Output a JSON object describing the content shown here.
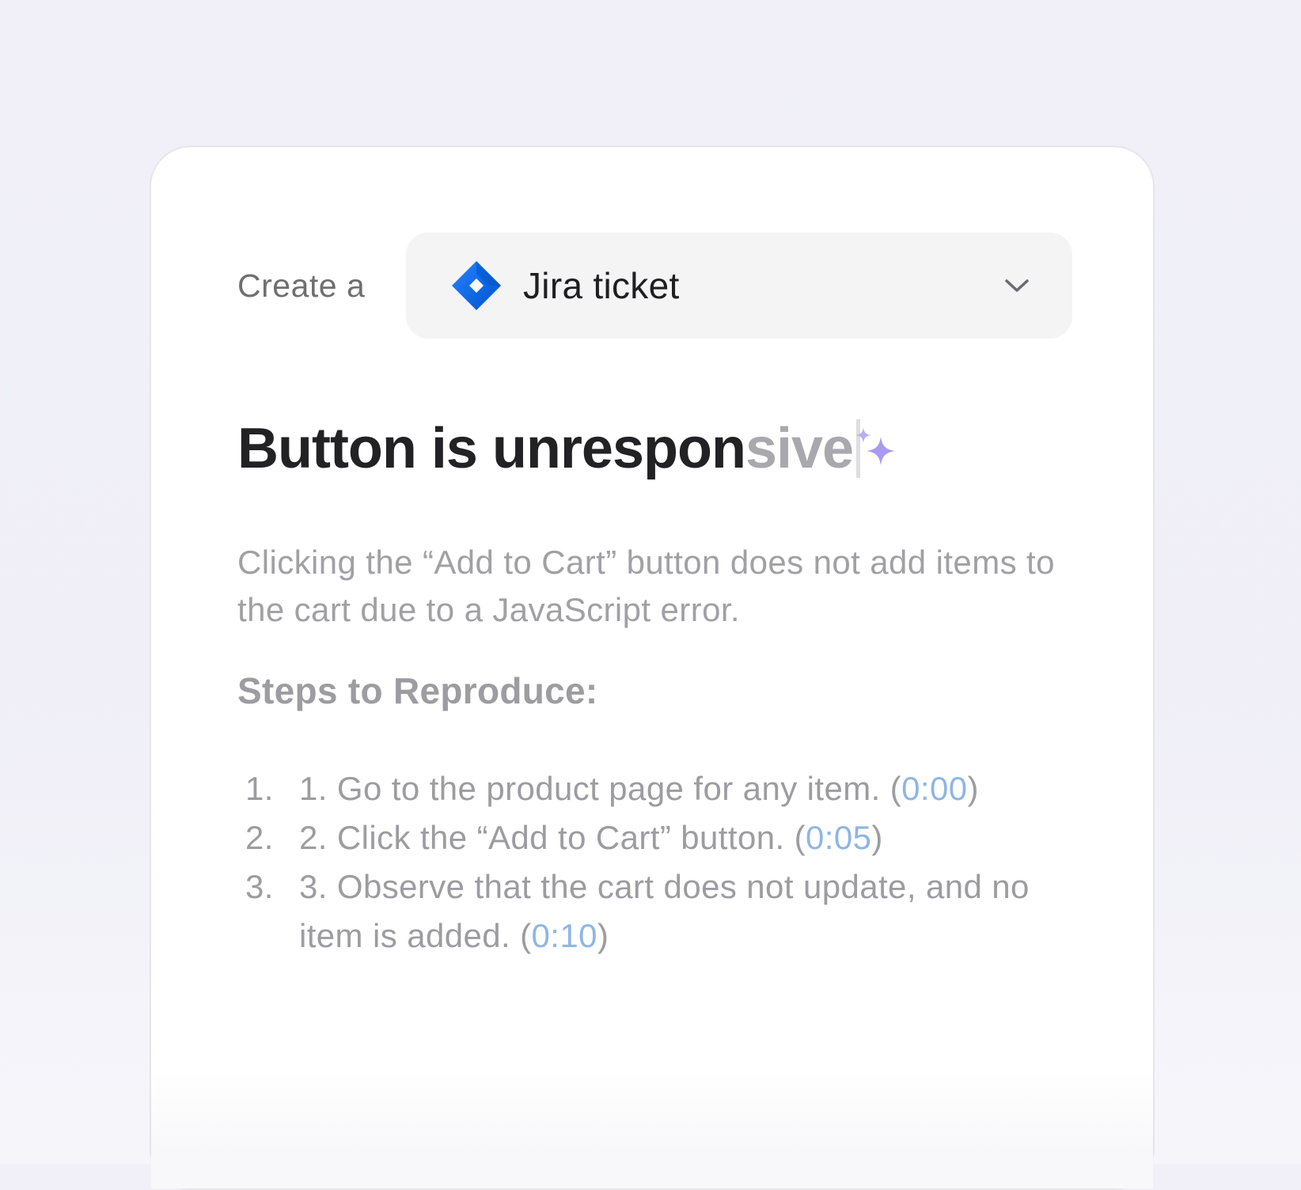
{
  "create_label": "Create a",
  "selector": {
    "label": "Jira ticket",
    "icon": "jira-icon",
    "chevron": "chevron-down-icon"
  },
  "title": {
    "typed": "Button is unrespon",
    "suggested": "sive"
  },
  "description": "Clicking the “Add to Cart” button does not add items to the cart due to a JavaScript error.",
  "steps_heading": "Steps to Reproduce:",
  "steps": [
    {
      "number": "1.",
      "text": "1. Go to the product page for any item. (",
      "timestamp": "0:00",
      "close": ")"
    },
    {
      "number": "2.",
      "text": "2. Click the “Add to Cart” button. (",
      "timestamp": "0:05",
      "close": ")"
    },
    {
      "number": "3.",
      "text": "3. Observe that the cart does not update, and no item is added. (",
      "timestamp": "0:10",
      "close": ")"
    }
  ],
  "colors": {
    "jira_blue": "#2684ff",
    "jira_dark": "#0052cc",
    "sparkle": "#a99af0",
    "timestamp": "#8fb6e6"
  }
}
